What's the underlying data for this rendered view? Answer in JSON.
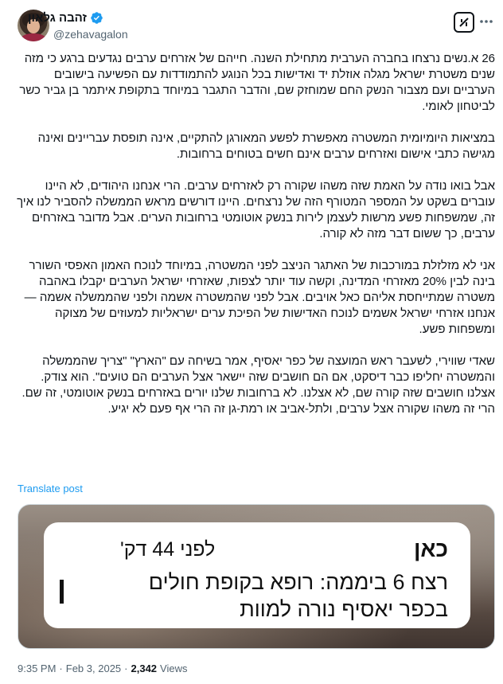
{
  "author": {
    "display_name": "זהבה גלאון",
    "handle": "@zehavagalon"
  },
  "post": {
    "paragraphs": [
      "26 א.נשים נרצחו בחברה הערבית מתחילת השנה. חייהם של אזרחים ערבים נגדעים ברגע כי מזה שנים משטרת ישראל מגלה אוזלת יד ואדישות בכל הנוגע להתמודדות עם הפשיעה בישובים הערביים ועם מצבור הנשק החם שמוחזק שם, והדבר התגבר במיוחד בתקופת איתמר בן גביר כשר לביטחון לאומי.",
      "במציאות היומיומית המשטרה מאפשרת לפשע המאורגן להתקיים, אינה תופסת עבריינים ואינה מגישה כתבי אישום ואזרחים ערבים אינם חשים בטוחים ברחובות.",
      "אבל בואו נודה על האמת שזה משהו שקורה רק לאזרחים ערבים. הרי אנחנו היהודים, לא היינו עוברים בשקט על המספר המטורף הזה של נרצחים. היינו דורשים מראש הממשלה להסביר לנו איך זה, שמשפחות פשע מרשות לעצמן לירות בנשק אוטומטי ברחובות הערים. אבל מדובר באזרחים ערבים, כך ששום דבר מזה לא קורה.",
      "אני לא מזלזלת במורכבות של האתגר הניצב לפני המשטרה, במיוחד לנוכח האמון האפסי השורר בינה לבין 20% מאזרחי המדינה, וקשה עוד יותר לצפות, שאזרחי ישראל הערבים יקבלו באהבה משטרה שמתייחסת אליהם כאל אויבים.  אבל לפני שהמשטרה אשמה ולפני שהממשלה אשמה — אנחנו אזרחי ישראל אשמים לנוכח האדישות של הפיכת ערים ישראליות למעוזים של מצוקה ומשפחות פשע.",
      "שאדי שווירי, לשעבר ראש המועצה של כפר יאסיף, אמר בשיחה עם \"הארץ\" \"צריך שהממשלה והמשטרה יחליפו כבר דיסקט, אם הם חושבים שזה יישאר אצל הערבים הם טועים\". הוא צודק. אצלנו חושבים שזה קורה שם, לא אצלנו.  לא ברחובות שלנו יורים באזרחים בנשק אוטומטי, זה שם. הרי זה משהו שקורה אצל ערבים, ולתל-אביב או רמת-גן זה הרי אף פעם לא יגיע."
    ],
    "translate_label": "Translate post"
  },
  "media_card": {
    "source": "כאן",
    "time_ago": "לפני 44 דק'",
    "headline": "רצח 6 ביממה: רופא בקופת חולים בכפר יאסיף נורה למוות"
  },
  "meta": {
    "time": "9:35 PM",
    "separator": "·",
    "date": "Feb 3, 2025",
    "views_count": "2,342",
    "views_label": "Views"
  },
  "icons": {
    "verified": "verified-badge-icon",
    "grok": "grok-icon",
    "more": "more-options-icon"
  },
  "colors": {
    "link": "#1d9bf0",
    "verified": "#1d9bf0",
    "secondary_text": "#536471"
  }
}
